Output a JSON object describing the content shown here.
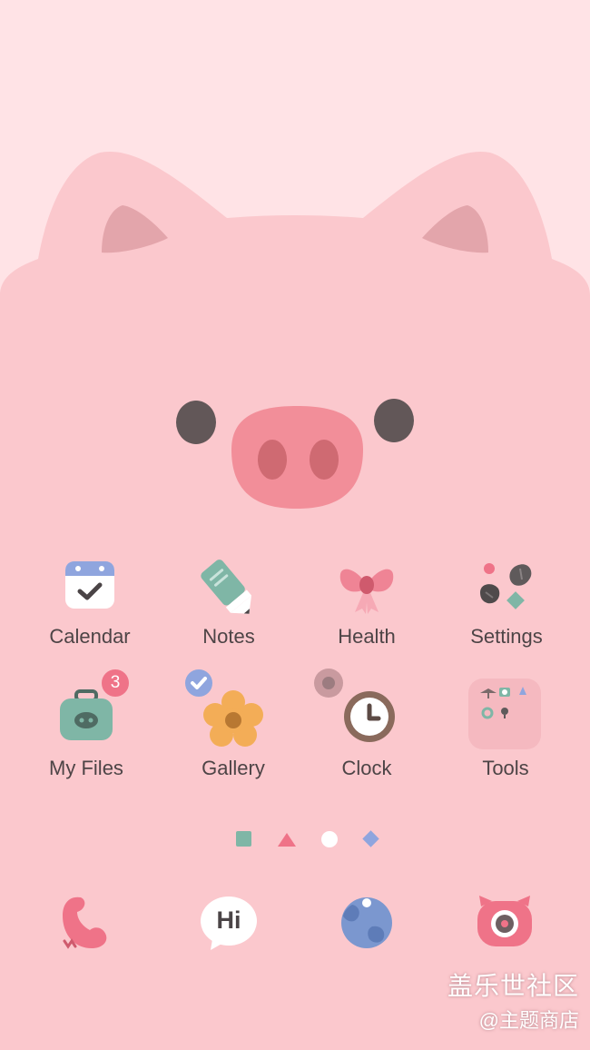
{
  "wallpaper": {
    "name": "pig-face-wallpaper"
  },
  "apps": {
    "calendar": {
      "label": "Calendar",
      "icon": "calendar-icon"
    },
    "notes": {
      "label": "Notes",
      "icon": "notes-icon"
    },
    "health": {
      "label": "Health",
      "icon": "bow-icon"
    },
    "settings": {
      "label": "Settings",
      "icon": "settings-icon"
    },
    "myfiles": {
      "label": "My Files",
      "icon": "briefcase-icon",
      "badge": "3"
    },
    "gallery": {
      "label": "Gallery",
      "icon": "flower-icon"
    },
    "clock": {
      "label": "Clock",
      "icon": "clock-icon"
    },
    "tools": {
      "label": "Tools",
      "icon": "folder-icon"
    }
  },
  "page_indicator": {
    "count": 4,
    "shapes": [
      "square",
      "triangle",
      "circle",
      "diamond"
    ],
    "current": 2
  },
  "dock": [
    {
      "name": "phone",
      "icon": "phone-icon"
    },
    {
      "name": "messages",
      "icon": "hi-bubble-icon",
      "text": "Hi"
    },
    {
      "name": "internet",
      "icon": "globe-icon"
    },
    {
      "name": "camera",
      "icon": "pig-camera-icon"
    }
  ],
  "watermark": {
    "line1": "盖乐世社区",
    "line2": "@主题商店"
  },
  "colors": {
    "background": "#ffe3e6",
    "pig": "#fbc8cd",
    "snout": "#f28e99",
    "accent": "#ef7388"
  }
}
